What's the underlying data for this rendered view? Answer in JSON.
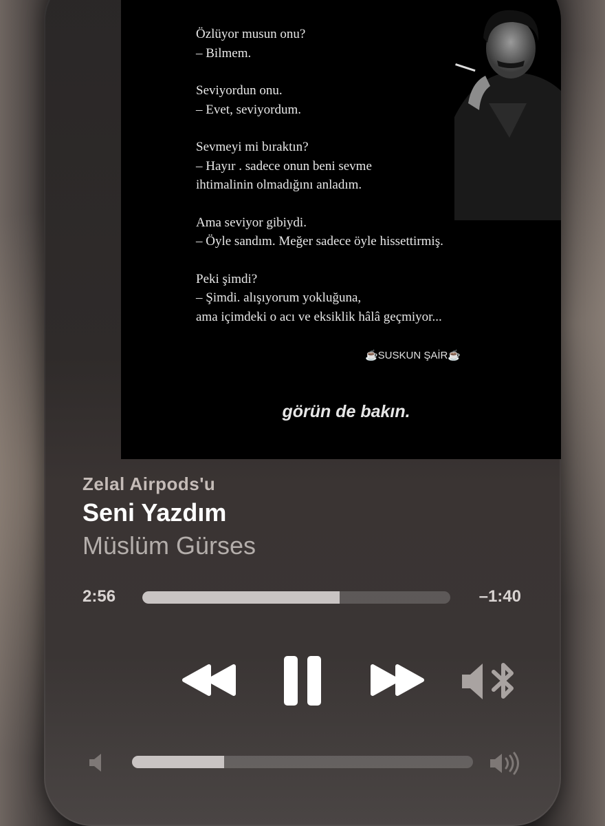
{
  "artwork": {
    "poem_stanzas": [
      "Özlüyor musun onu?\n– Bilmem.",
      "Seviyordun onu.\n– Evet, seviyordum.",
      "Sevmeyi mi bıraktın?\n– Hayır . sadece onun beni sevme\nihtimalinin olmadığını anladım.",
      "Ama seviyor gibiydi.\n– Öyle sandım. Meğer sadece öyle hissettirmiş.",
      "Peki şimdi?\n– Şimdi. alışıyorum yokluğuna,\nama içimdeki o acı ve eksiklik hâlâ geçmiyor..."
    ],
    "signature": "☕SUSKUN ŞAİR☕",
    "caption": "görün de bakın."
  },
  "now_playing": {
    "device": "Zelal Airpods'u",
    "title": "Seni Yazdım",
    "artist": "Müslüm Gürses"
  },
  "playback": {
    "elapsed": "2:56",
    "remaining": "–1:40",
    "progress_fraction": 0.64
  },
  "controls": {
    "rewind_icon": "rewind-icon",
    "pause_icon": "pause-icon",
    "forward_icon": "fast-forward-icon",
    "output_icon": "speaker-bluetooth-icon"
  },
  "volume": {
    "level_fraction": 0.27,
    "low_icon": "volume-low-icon",
    "high_icon": "volume-high-icon"
  },
  "colors": {
    "artwork_bg": "#000000",
    "text_primary": "#ffffff",
    "text_secondary": "#b4aeab",
    "track_fill": "#c9c4c3"
  }
}
